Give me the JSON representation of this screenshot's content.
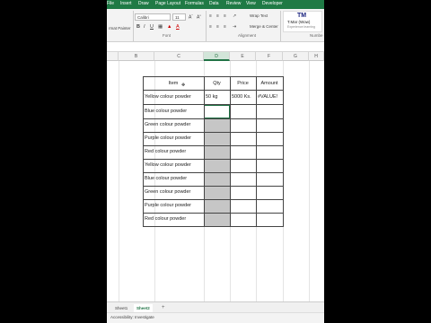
{
  "ribbon_tabs": [
    "Insert",
    "Draw",
    "Page Layout",
    "Formulas",
    "Data",
    "Review",
    "View",
    "Developer"
  ],
  "ribbon": {
    "file_partial": "File",
    "format_painter": "rmat Painter",
    "font_name": "Calibri",
    "font_size": "11",
    "wrap_text": "Wrap Text",
    "merge_center": "Merge & Center",
    "groups": [
      "Font",
      "Alignment",
      "Numbe"
    ]
  },
  "logo": {
    "mark": "TM",
    "name": "T.Mar (Wow)",
    "tagline": "Experience learning"
  },
  "columns": [
    "B",
    "C",
    "D",
    "E",
    "F",
    "G",
    "H"
  ],
  "selected_column": "D",
  "table": {
    "headers": {
      "item": "Item",
      "qty": "Qty",
      "price": "Price",
      "amount": "Amount"
    },
    "first_row": {
      "item": "Yellow colour powder",
      "qty": "50 kg",
      "price": "5000 Ks.",
      "amount": "#VALUE!"
    },
    "items": [
      "Blue colour powder",
      "Green colour powder",
      "Purple colour powder",
      "Red colour powder",
      "Yellow colour powder",
      "Blue colour powder",
      "Green colour powder",
      "Purple colour powder",
      "Red colour powder"
    ]
  },
  "sheet_tabs": [
    "Sheet1",
    "Sheet2"
  ],
  "active_sheet": "Sheet2",
  "add_sheet": "+",
  "status_text": "Accessibility: Investigate",
  "colors": {
    "accent": "#217346",
    "ribbon_green": "#1f7a45"
  }
}
